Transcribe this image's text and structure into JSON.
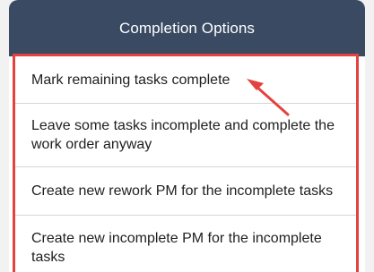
{
  "dialog": {
    "title": "Completion Options",
    "options": [
      {
        "label": "Mark remaining tasks complete"
      },
      {
        "label": "Leave some tasks incomplete and complete the work order anyway"
      },
      {
        "label": "Create new rework PM for the incomplete tasks"
      },
      {
        "label": "Create new incomplete PM for the incomplete tasks"
      }
    ]
  },
  "colors": {
    "header": "#3a4a63",
    "highlight": "#e3433e"
  },
  "annotation": {
    "icon": "red-arrow-icon"
  }
}
